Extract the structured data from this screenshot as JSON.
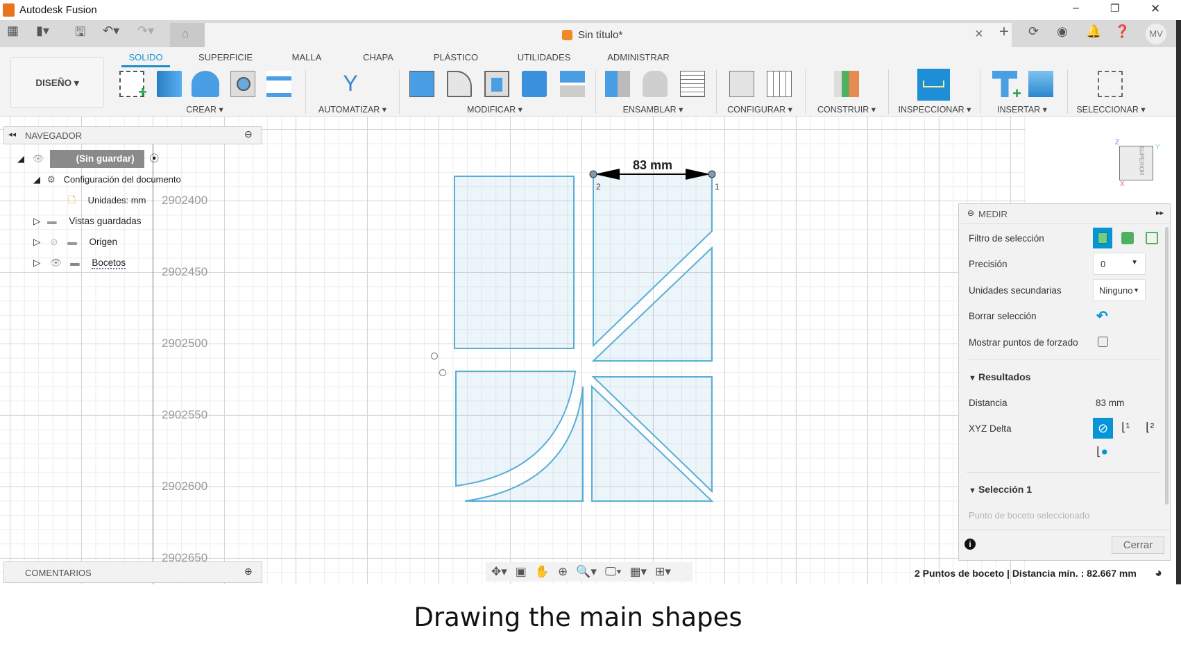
{
  "window": {
    "app_title": "Autodesk Fusion",
    "minimize": "–",
    "restore": "❐",
    "close": "✕"
  },
  "tabbar": {
    "doc_title": "Sin título*",
    "close_tab": "×",
    "new_tab": "+",
    "user_initials": "MV"
  },
  "ribbon": {
    "workspace": "DISEÑO ▾",
    "tabs": [
      "SOLIDO",
      "SUPERFICIE",
      "MALLA",
      "CHAPA",
      "PLÁSTICO",
      "UTILIDADES",
      "ADMINISTRAR"
    ],
    "active_tab": "SOLIDO",
    "groups": [
      "CREAR ▾",
      "AUTOMATIZAR ▾",
      "MODIFICAR ▾",
      "ENSAMBLAR ▾",
      "CONFIGURAR ▾",
      "CONSTRUIR ▾",
      "INSPECCIONAR ▾",
      "INSERTAR ▾",
      "SELECCIONAR ▾"
    ]
  },
  "navigator": {
    "title": "NAVEGADOR",
    "items": [
      {
        "label": "(Sin guardar)"
      },
      {
        "label": "Configuración del documento"
      },
      {
        "label": "Unidades: mm"
      },
      {
        "label": "Vistas guardadas"
      },
      {
        "label": "Origen"
      },
      {
        "label": "Bocetos"
      }
    ]
  },
  "comments": {
    "title": "COMENTARIOS"
  },
  "canvas": {
    "y_labels": [
      "2902400",
      "2902450",
      "2902500",
      "2902550",
      "2902600",
      "2902650"
    ],
    "dimension": "83 mm",
    "point_labels": [
      "2",
      "1"
    ],
    "viewcube": {
      "face": "SUPERIOR",
      "z": "Z",
      "x": "X",
      "y": "Y"
    },
    "sketch_color": "#5aaed6"
  },
  "measure": {
    "title": "MEDIR",
    "selection_filter": "Filtro de selección",
    "precision_label": "Precisión",
    "precision_value": "0",
    "secondary_units_label": "Unidades secundarias",
    "secondary_units_value": "Ninguno",
    "clear_selection": "Borrar selección",
    "show_snap_points": "Mostrar puntos de forzado",
    "show_snap_points_checked": false,
    "results_title": "Resultados",
    "distance_label": "Distancia",
    "distance_value": "83 mm",
    "xyz_delta": "XYZ Delta",
    "selection1_title": "Selección 1",
    "selection1_value": "Punto de boceto seleccionado",
    "close_button": "Cerrar",
    "accent": "#0696d7"
  },
  "status": {
    "text": "2 Puntos de boceto | Distancia mín. : 82.667 mm"
  },
  "caption": "Drawing the main shapes"
}
